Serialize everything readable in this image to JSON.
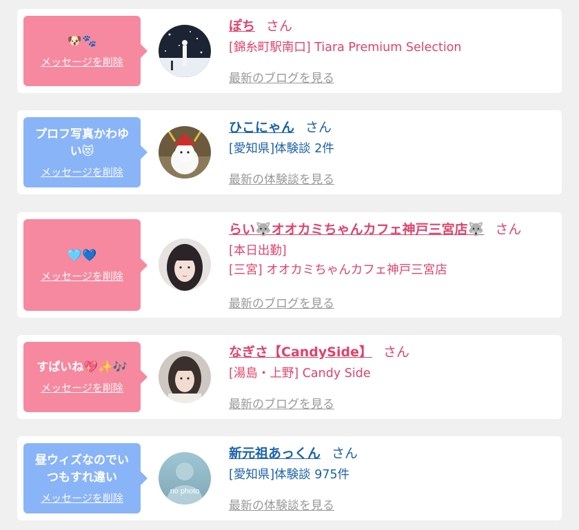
{
  "items": [
    {
      "theme": "pink",
      "message": "🐶🐾",
      "delete_label": "メッセージを削除",
      "avatar": "photo-woman-snow-scene",
      "name": "ぽち",
      "honorific": "さん",
      "details": [
        "[錦糸町駅南口] Tiara Premium Selection"
      ],
      "more_label": "最新のブログを見る"
    },
    {
      "theme": "blue",
      "message": "プロフ写真かわゆい😻",
      "delete_label": "メッセージを削除",
      "avatar": "photo-mascot-character",
      "name": "ひこにゃん",
      "honorific": "さん",
      "details": [
        "[愛知県]体験談 2件"
      ],
      "more_label": "最新の体験談を見る"
    },
    {
      "theme": "pink",
      "message": "🩵💙",
      "delete_label": "メッセージを削除",
      "avatar": "photo-woman-portrait",
      "name": "らい🐺オオカミちゃんカフェ神戸三宮店🐺",
      "honorific": "さん",
      "details": [
        "[本日出勤]",
        "[三宮] オオカミちゃんカフェ神戸三宮店"
      ],
      "more_label": "最新のブログを見る"
    },
    {
      "theme": "pink",
      "message": "すぱいね💖✨🎶",
      "delete_label": "メッセージを削除",
      "avatar": "photo-woman-portrait-2",
      "name": "なぎさ【CandySide】",
      "honorific": "さん",
      "details": [
        "[湯島・上野] Candy Side"
      ],
      "more_label": "最新のブログを見る"
    },
    {
      "theme": "blue",
      "message": "昼ウィズなのでいつもすれ違い",
      "delete_label": "メッセージを削除",
      "avatar": "no-photo-placeholder",
      "avatar_text": "no photo",
      "name": "新元祖あっくん",
      "honorific": "さん",
      "details": [
        "[愛知県]体験談 975件"
      ],
      "more_label": "最新の体験談を見る"
    }
  ],
  "colors": {
    "pink_accent": "#e0426b",
    "blue_accent": "#1b62a8",
    "pink_bubble": "#f6899f",
    "blue_bubble": "#8ab4f8",
    "muted_link": "#999999"
  }
}
